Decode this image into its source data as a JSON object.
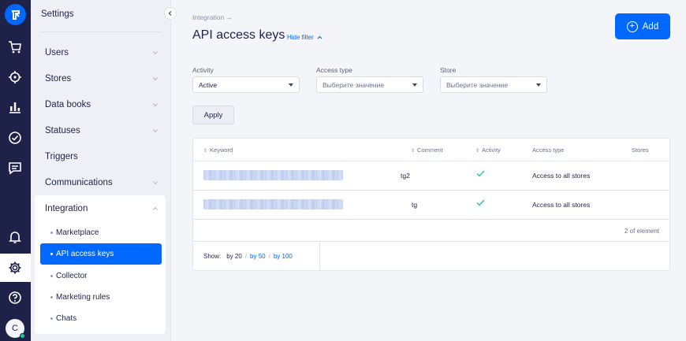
{
  "rail": {
    "avatar_letter": "C",
    "icons": [
      "retailcrm-logo",
      "cart-icon",
      "crosshair-icon",
      "analytics-icon",
      "tasks-icon",
      "chat-icon",
      "bell-icon",
      "gear-icon",
      "help-icon"
    ]
  },
  "sidebar": {
    "title": "Settings",
    "items": [
      {
        "label": "Users",
        "has_chevron": true
      },
      {
        "label": "Stores",
        "has_chevron": true
      },
      {
        "label": "Data books",
        "has_chevron": true
      },
      {
        "label": "Statuses",
        "has_chevron": true
      },
      {
        "label": "Triggers",
        "has_chevron": false
      },
      {
        "label": "Communications",
        "has_chevron": true
      }
    ],
    "group": {
      "label": "Integration",
      "expanded": true,
      "children": [
        {
          "label": "Marketplace",
          "active": false
        },
        {
          "label": "API access keys",
          "active": true
        },
        {
          "label": "Collector",
          "active": false
        },
        {
          "label": "Marketing rules",
          "active": false
        },
        {
          "label": "Chats",
          "active": false
        }
      ]
    }
  },
  "header": {
    "breadcrumb": "Integration →",
    "title": "API access keys",
    "hide_filter": "Hide filter",
    "add_label": "Add"
  },
  "filters": {
    "activity": {
      "label": "Activity",
      "value": "Active"
    },
    "access_type": {
      "label": "Access type",
      "value": "Выберите значение"
    },
    "store": {
      "label": "Store",
      "value": "Выберите значение"
    },
    "apply_label": "Apply"
  },
  "table": {
    "columns": [
      "Keyword",
      "Comment",
      "Activity",
      "Access type",
      "Stores"
    ],
    "rows": [
      {
        "keyword_hidden": true,
        "comment": "tg2",
        "active": true,
        "access_type": "Access to all stores",
        "stores": ""
      },
      {
        "keyword_hidden": true,
        "comment": "tg",
        "active": true,
        "access_type": "Access to all stores",
        "stores": ""
      }
    ],
    "count_text": "2 of element",
    "pager": {
      "show_label": "Show:",
      "options": [
        "by 20",
        "by 50",
        "by 100"
      ],
      "separator": "/",
      "current": "by 20"
    }
  },
  "colors": {
    "accent": "#0068ff",
    "rail_bg": "#1e2248",
    "check": "#22c993"
  }
}
